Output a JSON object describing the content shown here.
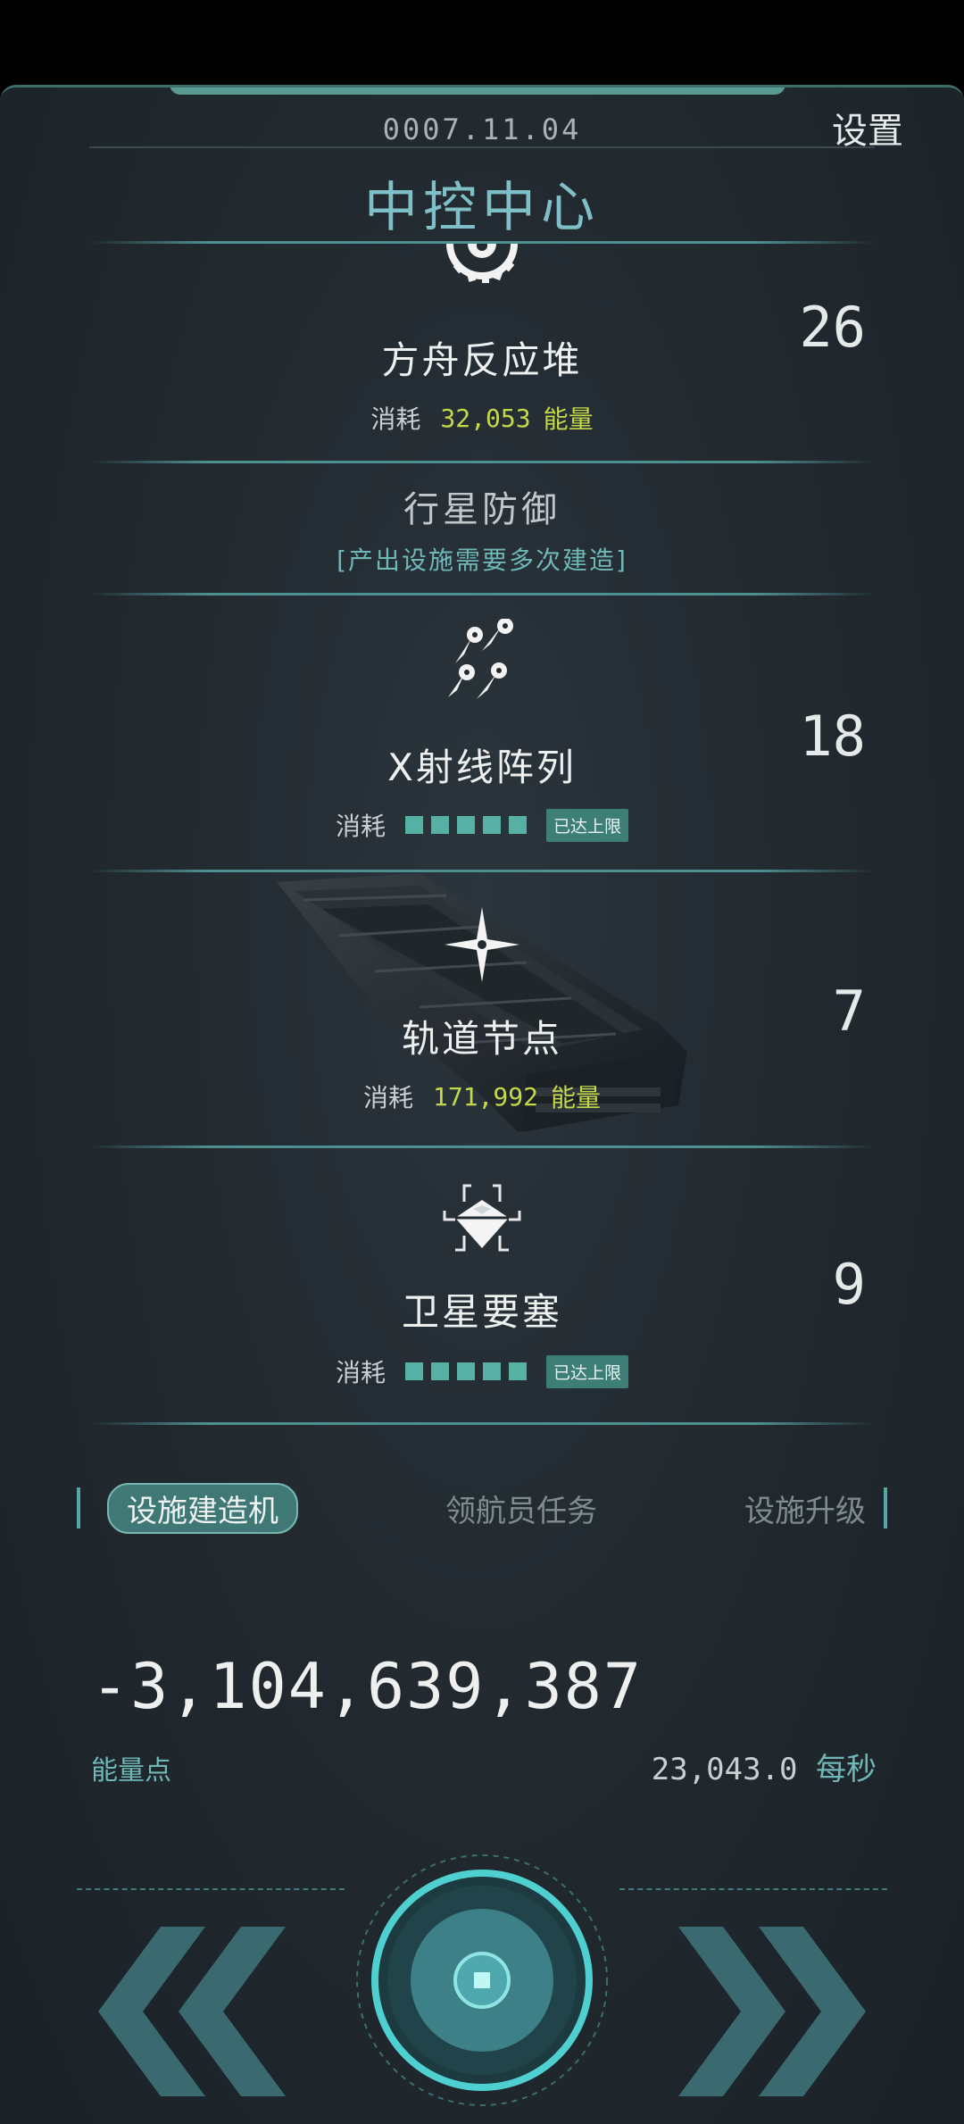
{
  "header": {
    "date": "0007.11.04",
    "settings_label": "设置",
    "title": "中控中心"
  },
  "items": [
    {
      "name": "方舟反应堆",
      "count": "26",
      "cost_label": "消耗",
      "cost_value": "32,053",
      "cost_unit": "能量",
      "icon": "gear-reactor-icon"
    },
    {
      "name": "X射线阵列",
      "count": "18",
      "cost_label": "消耗",
      "maxed_label": "已达上限",
      "level": 5,
      "icon": "x-ray-array-icon"
    },
    {
      "name": "轨道节点",
      "count": "7",
      "cost_label": "消耗",
      "cost_value": "171,992",
      "cost_unit": "能量",
      "icon": "star-node-icon"
    },
    {
      "name": "卫星要塞",
      "count": "9",
      "cost_label": "消耗",
      "maxed_label": "已达上限",
      "level": 5,
      "icon": "satellite-fortress-icon"
    }
  ],
  "section": {
    "title": "行星防御",
    "note": "[产出设施需要多次建造]"
  },
  "tabs": [
    {
      "label": "设施建造机",
      "active": true
    },
    {
      "label": "领航员任务",
      "active": false
    },
    {
      "label": "设施升级",
      "active": false
    }
  ],
  "energy": {
    "value": "-3,104,639,387",
    "label": "能量点",
    "rate_value": "23,043.0",
    "rate_unit": "每秒"
  },
  "colors": {
    "accent": "#56b0a4",
    "title": "#7fc0c8",
    "cost": "#c5d84a",
    "background": "#222a30"
  }
}
